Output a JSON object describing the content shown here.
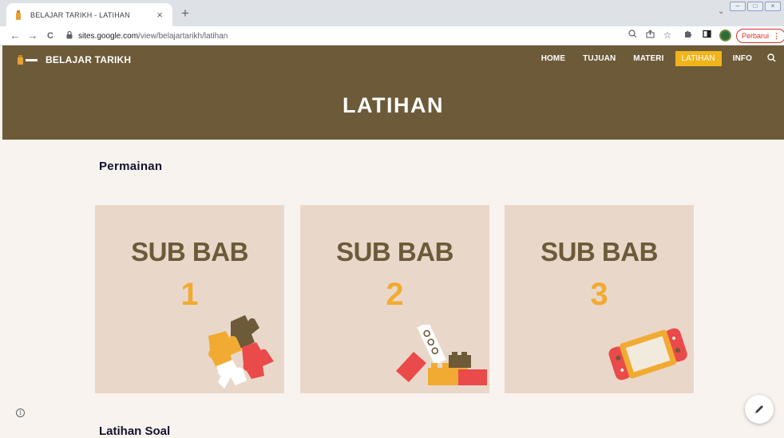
{
  "browser": {
    "tab_title": "BELAJAR TARIKH - LATIHAN",
    "tab_close": "×",
    "new_tab": "+",
    "tab_search": "⌄",
    "url_host": "sites.google.com",
    "url_path": "/view/belajartarikh/latihan",
    "update_label": "Perbarui",
    "update_menu": "⋮",
    "nav": {
      "back": "←",
      "forward": "→",
      "reload": "C"
    }
  },
  "site": {
    "brand_name": "BELAJAR TARIKH",
    "nav_items": [
      {
        "label": "HOME"
      },
      {
        "label": "TUJUAN"
      },
      {
        "label": "MATERI"
      },
      {
        "label": "LATIHAN",
        "active": true
      },
      {
        "label": "INFO"
      }
    ],
    "page_title": "LATIHAN",
    "accent_color": "#f1b41a",
    "header_color": "#6d5a39"
  },
  "content": {
    "section_title": "Permainan",
    "cards": [
      {
        "heading": "SUB BAB",
        "number": "1",
        "art": "puzzle-icon"
      },
      {
        "heading": "SUB BAB",
        "number": "2",
        "art": "building-blocks-icon"
      },
      {
        "heading": "SUB BAB",
        "number": "3",
        "art": "game-console-icon"
      }
    ],
    "next_section_title": "Latihan Soal"
  }
}
